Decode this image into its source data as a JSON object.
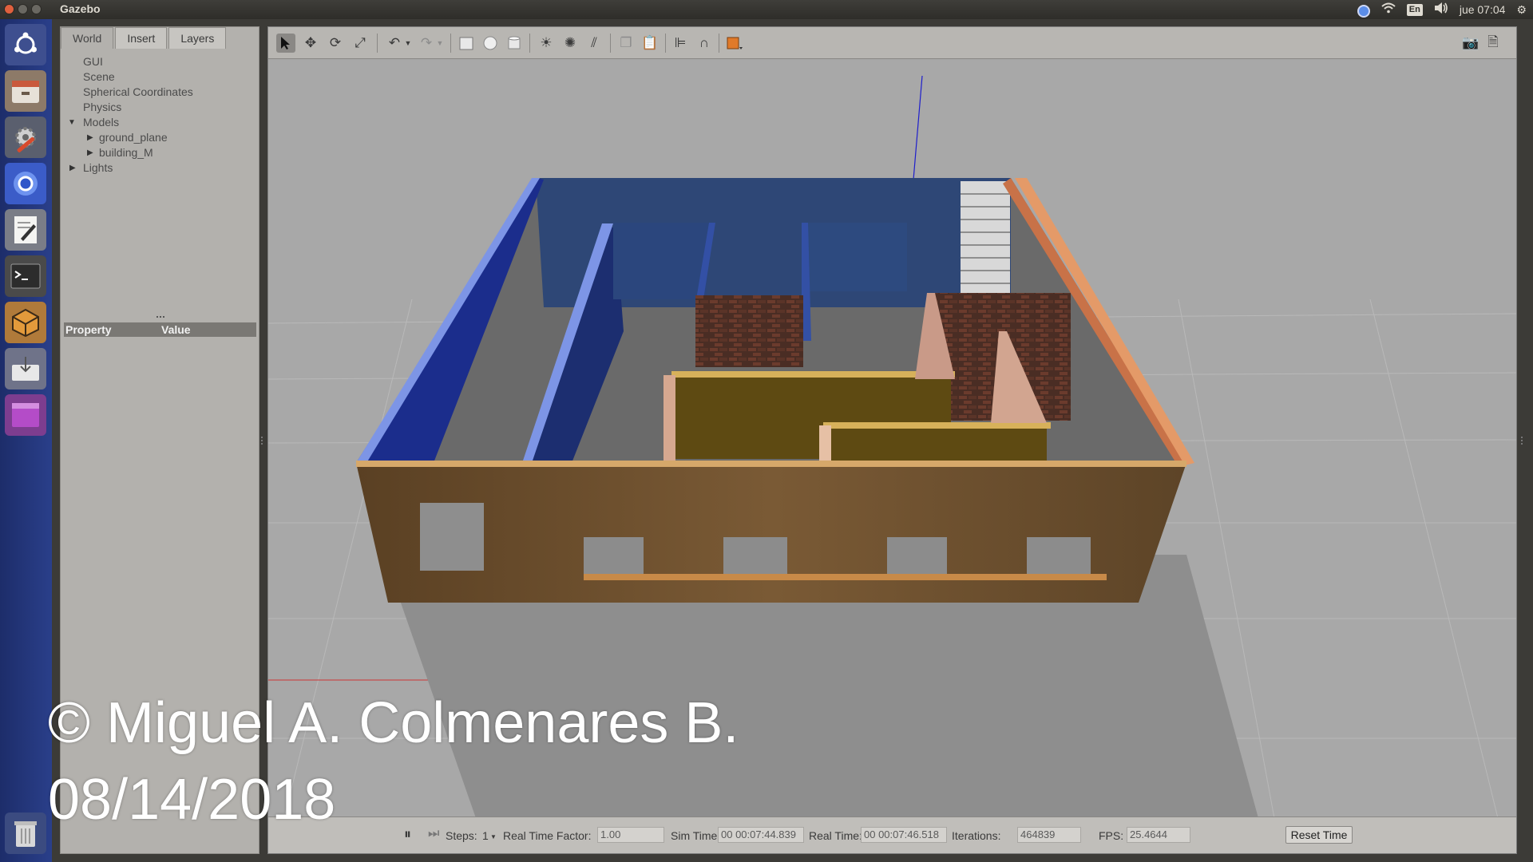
{
  "window": {
    "app_title": "Gazebo"
  },
  "system_tray": {
    "keyboard_layout": "En",
    "clock": "jue 07:04",
    "icons": [
      "chromium-icon",
      "wifi-icon",
      "keyboard-icon",
      "volume-icon",
      "settings-gear-icon"
    ]
  },
  "launcher": {
    "items": [
      "ubuntu-dash-icon",
      "files-icon",
      "system-settings-icon",
      "chromium-icon",
      "text-editor-icon",
      "terminal-icon",
      "gazebo-icon",
      "software-installer-icon",
      "workspace-switcher-icon",
      "trash-icon"
    ]
  },
  "left_panel": {
    "tabs": [
      "World",
      "Insert",
      "Layers"
    ],
    "active_tab": "World",
    "tree": {
      "gui": "GUI",
      "scene": "Scene",
      "spherical_coordinates": "Spherical Coordinates",
      "physics": "Physics",
      "models": "Models",
      "ground_plane": "ground_plane",
      "building": "building_M",
      "lights": "Lights"
    },
    "property_table": {
      "col_property": "Property",
      "col_value": "Value"
    }
  },
  "toolbar": {
    "tools": [
      "select-arrow-icon",
      "translate-icon",
      "rotate-icon",
      "scale-icon",
      "undo-icon",
      "redo-icon",
      "box-shape-icon",
      "sphere-shape-icon",
      "cylinder-shape-icon",
      "point-light-icon",
      "spot-light-icon",
      "directional-light-icon",
      "copy-icon",
      "paste-icon",
      "align-icon",
      "snap-icon",
      "view-angle-icon",
      "screenshot-icon",
      "log-icon"
    ],
    "active_tool": "select-arrow-icon"
  },
  "bottom_bar": {
    "steps_label": "Steps:",
    "steps_value": "1",
    "rtf_label": "Real Time Factor:",
    "rtf_value": "1.00",
    "sim_time_label": "Sim Time:",
    "sim_time_value": "00 00:07:44.839",
    "real_time_label": "Real Time:",
    "real_time_value": "00 00:07:46.518",
    "iterations_label": "Iterations:",
    "iterations_value": "464839",
    "fps_label": "FPS:",
    "fps_value": "25.4644",
    "reset_button": "Reset Time"
  },
  "watermark": {
    "line1": "© Miguel A. Colmenares B.",
    "line2": "08/14/2018"
  },
  "colors": {
    "wall_blue": "#1e2f8a",
    "wall_blue_light": "#6d86e0",
    "wall_orange": "#c87a4c",
    "wall_yellow": "#5c4a10",
    "wood": "#6e5331",
    "brick": "#4a2e26",
    "floor": "#6b6b6b",
    "ground_grid": "#a6a6a6"
  }
}
